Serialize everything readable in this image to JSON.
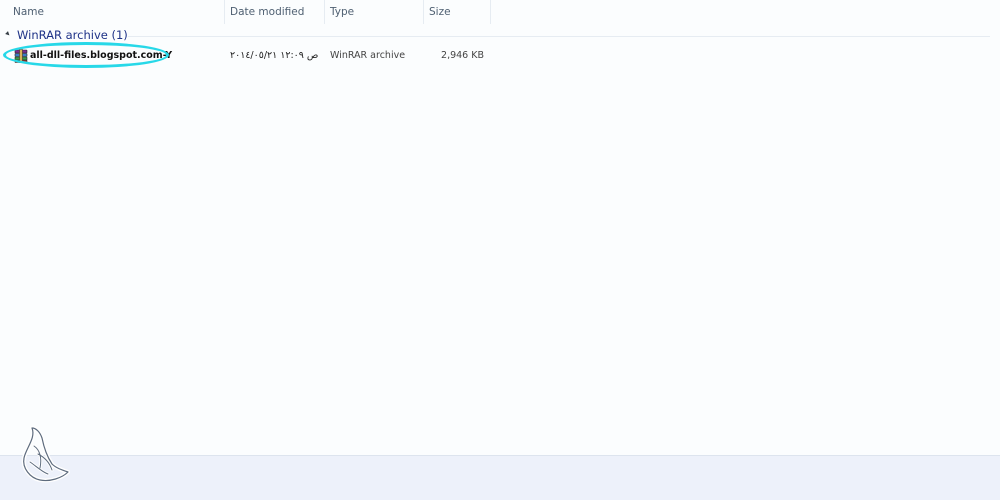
{
  "columns": {
    "name": "Name",
    "date_modified": "Date modified",
    "type": "Type",
    "size": "Size"
  },
  "group": {
    "title": "WinRAR archive (1)"
  },
  "files": [
    {
      "name": "all-dll-files.blogspot.com-Y",
      "date_modified": "۲۰۱٤/۰٥/۲۱ ص ۱۲:۰۹",
      "type": "WinRAR archive",
      "size": "2,946 KB",
      "icon": "winrar-archive-icon"
    }
  ],
  "colors": {
    "highlight": "#27d8e8",
    "group_title": "#1e3287",
    "header_text": "#4f6072",
    "status_bar": "#edf1fa"
  }
}
